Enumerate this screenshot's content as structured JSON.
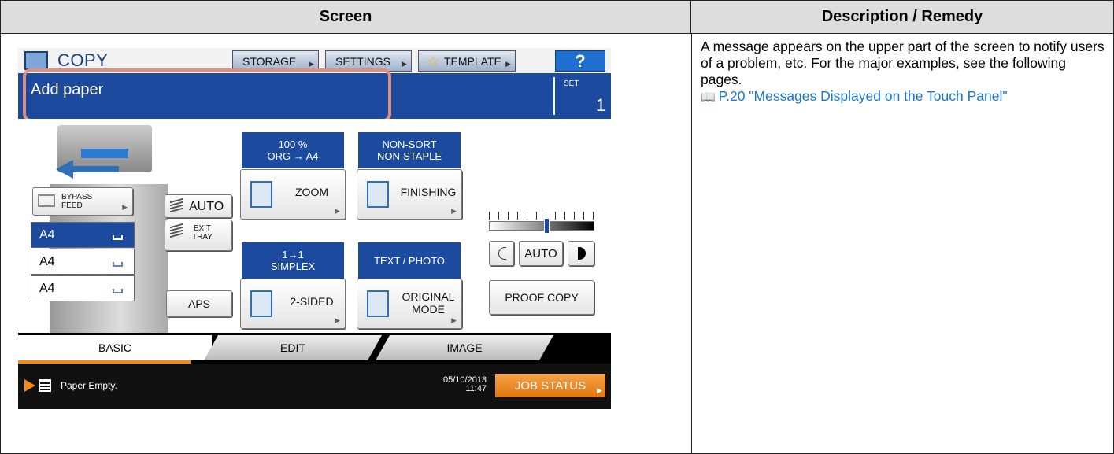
{
  "table": {
    "header_screen": "Screen",
    "header_description": "Description / Remedy",
    "description": "A message appears on the upper part of the screen to notify users of a problem, etc. For the major examples, see the following pages.",
    "reference_link": "P.20 \"Messages Displayed on the Touch Panel\""
  },
  "panel": {
    "mode_title": "COPY",
    "top_buttons": {
      "storage": "STORAGE",
      "settings": "SETTINGS",
      "template": "TEMPLATE",
      "help": "?"
    },
    "message": "Add paper",
    "set_label": "SET",
    "set_value": "1",
    "bypass_line1": "BYPASS",
    "bypass_line2": "FEED",
    "trays": [
      "A4",
      "A4",
      "A4"
    ],
    "paper_auto": "AUTO",
    "exit_tray_line1": "EXIT",
    "exit_tray_line2": "TRAY",
    "aps": "APS",
    "zoom_header_line1": "100 %",
    "zoom_header_line2": "ORG  →  A4",
    "zoom_button": "ZOOM",
    "finishing_header_line1": "NON-SORT",
    "finishing_header_line2": "NON-STAPLE",
    "finishing_button": "FINISHING",
    "duplex_header_line1": "1→1",
    "duplex_header_line2": "SIMPLEX",
    "duplex_button": "2-SIDED",
    "mode_header": "TEXT / PHOTO",
    "mode_button_line1": "ORIGINAL",
    "mode_button_line2": "MODE",
    "density_auto": "AUTO",
    "density_level": 0.55,
    "proof_copy": "PROOF COPY",
    "tabs": [
      "BASIC",
      "EDIT",
      "IMAGE"
    ],
    "status_message": "Paper Empty.",
    "date": "05/10/2013",
    "time": "11:47",
    "job_status": "JOB STATUS"
  },
  "colors": {
    "message_bar": "#1b4a9e",
    "highlight": "#e08f7f",
    "accent_orange": "#f28a1c",
    "link": "#1976d2"
  }
}
